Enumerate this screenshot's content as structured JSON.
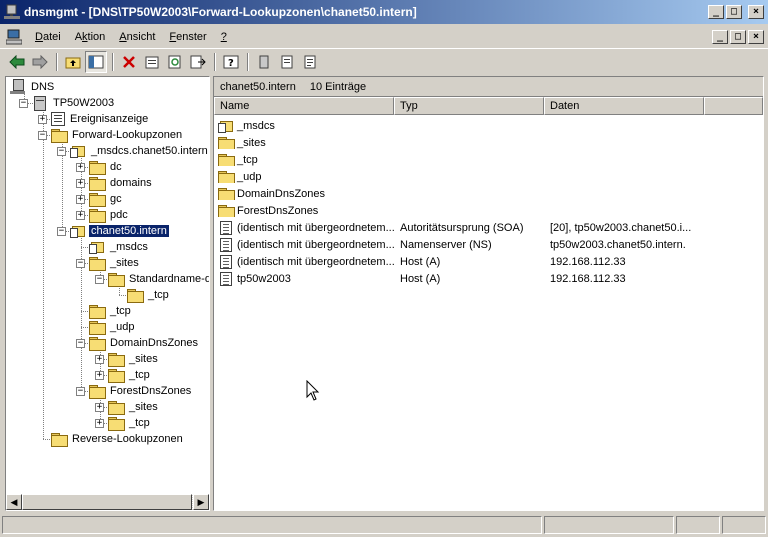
{
  "window": {
    "title": "dnsmgmt - [DNS\\TP50W2003\\Forward-Lookupzonen\\chanet50.intern]",
    "controls": [
      "_",
      "□",
      "×"
    ]
  },
  "menu": [
    {
      "label": "Datei",
      "accel": "D"
    },
    {
      "label": "Aktion",
      "accel": "k"
    },
    {
      "label": "Ansicht",
      "accel": "A"
    },
    {
      "label": "Fenster",
      "accel": "F"
    },
    {
      "label": "?",
      "accel": "?"
    }
  ],
  "toolbar": [
    {
      "name": "back-icon",
      "glyph": "⇦",
      "color": "#0a7a3a"
    },
    {
      "name": "forward-icon",
      "glyph": "⇨",
      "color": "#808080"
    },
    {
      "name": "up-folder-icon"
    },
    {
      "name": "show-tree-icon",
      "pressed": true
    },
    {
      "name": "delete-icon",
      "glyph": "✕",
      "color": "#cc0000"
    },
    {
      "name": "properties-icon"
    },
    {
      "name": "refresh-icon"
    },
    {
      "name": "export-list-icon"
    },
    {
      "name": "help-icon",
      "glyph": "?"
    },
    {
      "name": "new-host-icon"
    },
    {
      "name": "new-record-icon"
    },
    {
      "name": "new-delegation-icon"
    }
  ],
  "tree": {
    "items": [
      {
        "label": "DNS",
        "icon": "dns",
        "depth": 0
      },
      {
        "label": "TP50W2003",
        "icon": "server",
        "depth": 1,
        "exp": "−"
      },
      {
        "label": "Ereignisanzeige",
        "icon": "evt",
        "depth": 2,
        "exp": "+"
      },
      {
        "label": "Forward-Lookupzonen",
        "icon": "folder",
        "depth": 2,
        "exp": "−"
      },
      {
        "label": "_msdcs.chanet50.intern",
        "icon": "zone",
        "depth": 3,
        "exp": "−"
      },
      {
        "label": "dc",
        "icon": "folder",
        "depth": 4,
        "exp": "+"
      },
      {
        "label": "domains",
        "icon": "folder",
        "depth": 4,
        "exp": "+"
      },
      {
        "label": "gc",
        "icon": "folder",
        "depth": 4,
        "exp": "+"
      },
      {
        "label": "pdc",
        "icon": "folder",
        "depth": 4,
        "exp": "+"
      },
      {
        "label": "chanet50.intern",
        "icon": "zone",
        "depth": 3,
        "exp": "−",
        "selected": true
      },
      {
        "label": "_msdcs",
        "icon": "zone",
        "depth": 4
      },
      {
        "label": "_sites",
        "icon": "folder",
        "depth": 4,
        "exp": "−"
      },
      {
        "label": "Standardname-de",
        "icon": "folder",
        "depth": 5,
        "exp": "−"
      },
      {
        "label": "_tcp",
        "icon": "folder",
        "depth": 6
      },
      {
        "label": "_tcp",
        "icon": "folder",
        "depth": 4
      },
      {
        "label": "_udp",
        "icon": "folder",
        "depth": 4
      },
      {
        "label": "DomainDnsZones",
        "icon": "folder",
        "depth": 4,
        "exp": "−"
      },
      {
        "label": "_sites",
        "icon": "folder",
        "depth": 5,
        "exp": "+"
      },
      {
        "label": "_tcp",
        "icon": "folder",
        "depth": 5,
        "exp": "+"
      },
      {
        "label": "ForestDnsZones",
        "icon": "folder",
        "depth": 4,
        "exp": "−"
      },
      {
        "label": "_sites",
        "icon": "folder",
        "depth": 5,
        "exp": "+"
      },
      {
        "label": "_tcp",
        "icon": "folder",
        "depth": 5,
        "exp": "+"
      },
      {
        "label": "Reverse-Lookupzonen",
        "icon": "folder",
        "depth": 2
      }
    ]
  },
  "right": {
    "zone_name": "chanet50.intern",
    "count": "10 Einträge",
    "columns": [
      "Name",
      "Typ",
      "Daten"
    ],
    "rows": [
      {
        "name": "_msdcs",
        "icon": "zone",
        "type": "",
        "data": ""
      },
      {
        "name": "_sites",
        "icon": "folder",
        "type": "",
        "data": ""
      },
      {
        "name": "_tcp",
        "icon": "folder",
        "type": "",
        "data": ""
      },
      {
        "name": "_udp",
        "icon": "folder",
        "type": "",
        "data": ""
      },
      {
        "name": "DomainDnsZones",
        "icon": "folder",
        "type": "",
        "data": ""
      },
      {
        "name": "ForestDnsZones",
        "icon": "folder",
        "type": "",
        "data": ""
      },
      {
        "name": "(identisch mit übergeordnetem...",
        "icon": "rec",
        "type": "Autoritätsursprung (SOA)",
        "data": "[20], tp50w2003.chanet50.i..."
      },
      {
        "name": "(identisch mit übergeordnetem...",
        "icon": "rec",
        "type": "Namenserver (NS)",
        "data": "tp50w2003.chanet50.intern."
      },
      {
        "name": "(identisch mit übergeordnetem...",
        "icon": "rec",
        "type": "Host (A)",
        "data": "192.168.112.33"
      },
      {
        "name": "tp50w2003",
        "icon": "rec",
        "type": "Host (A)",
        "data": "192.168.112.33"
      }
    ]
  },
  "status": [
    "",
    "",
    "",
    ""
  ]
}
